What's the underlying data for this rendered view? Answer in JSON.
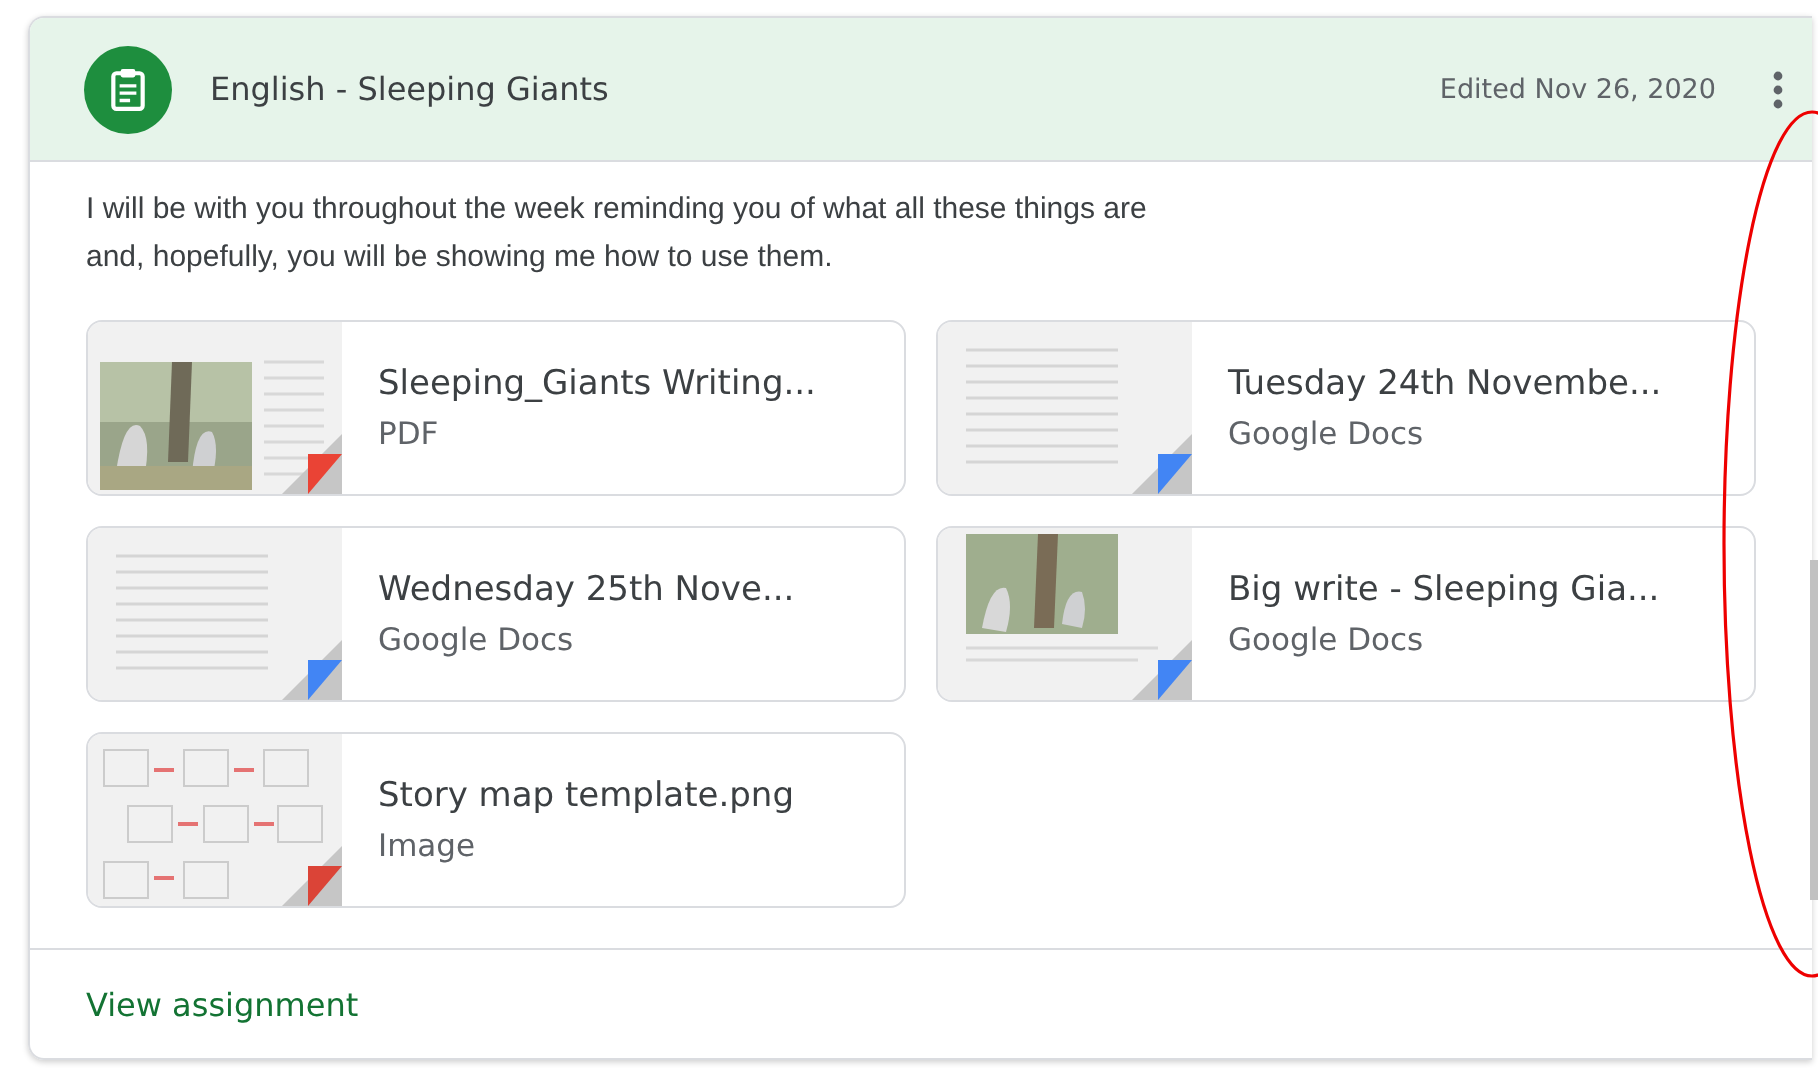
{
  "assignment": {
    "title": "English - Sleeping Giants",
    "edited": "Edited Nov 26, 2020",
    "description": "I will be with you throughout the week reminding you of what all these things are\nand, hopefully, you will be showing me how to use them.",
    "attachments": [
      {
        "name": "Sleeping_Giants Writing...",
        "type": "PDF",
        "kind": "pdf"
      },
      {
        "name": "Tuesday 24th Novembe...",
        "type": "Google Docs",
        "kind": "docs"
      },
      {
        "name": "Wednesday 25th Nove...",
        "type": "Google Docs",
        "kind": "docs"
      },
      {
        "name": "Big write - Sleeping Gia...",
        "type": "Google Docs",
        "kind": "docsphoto"
      },
      {
        "name": "Story map template.png",
        "type": "Image",
        "kind": "image"
      }
    ],
    "link": "View assignment"
  }
}
